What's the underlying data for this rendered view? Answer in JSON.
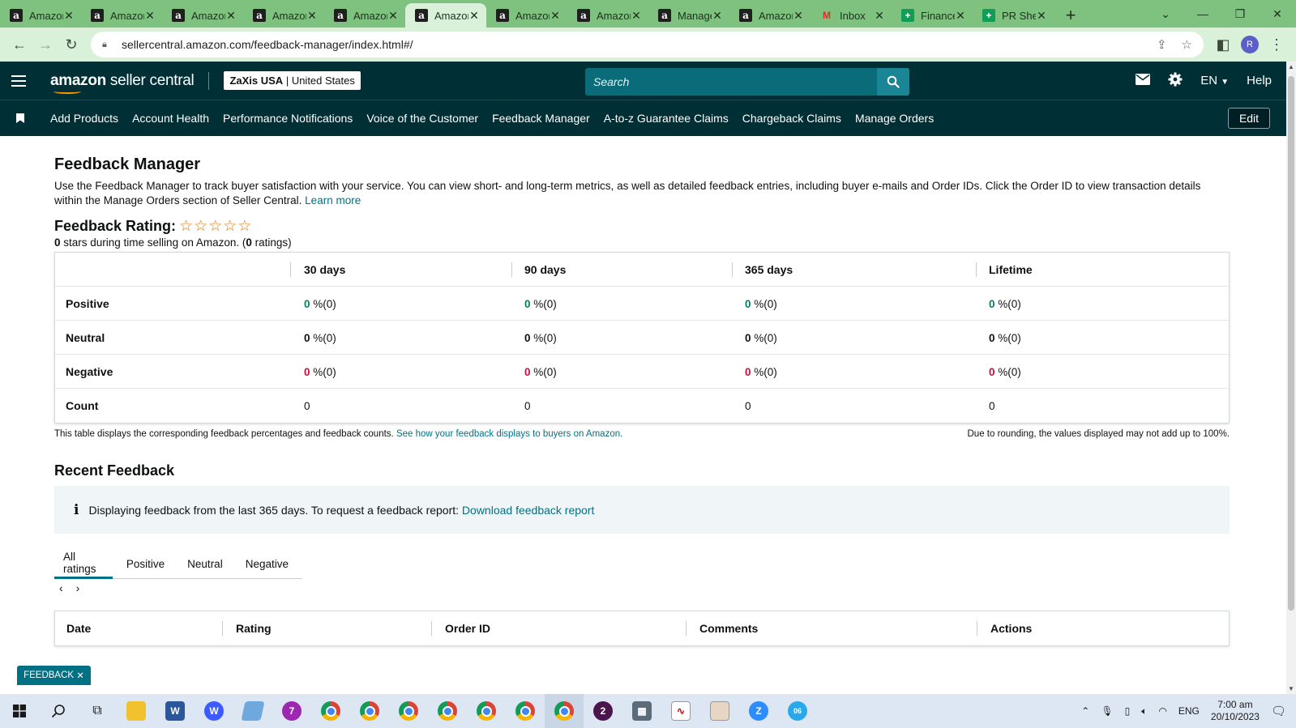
{
  "browser": {
    "tabs": [
      {
        "title": "Amazon",
        "favicon": "amazon-icon",
        "active": false
      },
      {
        "title": "Amazon",
        "favicon": "amazon-icon",
        "active": false
      },
      {
        "title": "Amazon",
        "favicon": "amazon-icon",
        "active": false
      },
      {
        "title": "Amazon",
        "favicon": "amazon-icon",
        "active": false
      },
      {
        "title": "Amazon",
        "favicon": "amazon-icon",
        "active": false
      },
      {
        "title": "Amazon",
        "favicon": "amazon-icon",
        "active": true
      },
      {
        "title": "Amazon",
        "favicon": "amazon-icon",
        "active": false
      },
      {
        "title": "Amazon",
        "favicon": "amazon-icon",
        "active": false
      },
      {
        "title": "Manage",
        "favicon": "amazon-icon",
        "active": false
      },
      {
        "title": "Amazon",
        "favicon": "amazon-icon",
        "active": false
      },
      {
        "title": "Inbox",
        "favicon": "gmail-icon",
        "active": false
      },
      {
        "title": "Finance",
        "favicon": "sheets-icon",
        "active": false
      },
      {
        "title": "PR Sheet",
        "favicon": "sheets-icon",
        "active": false
      }
    ],
    "url": "sellercentral.amazon.com/feedback-manager/index.html#/",
    "profile_initial": "R"
  },
  "header": {
    "logo_bold": "amazon",
    "logo_light": " seller central",
    "account_name": "ZaXis USA",
    "account_region": "United States",
    "search_placeholder": "Search",
    "language": "EN",
    "help_label": "Help"
  },
  "nav": {
    "items": [
      "Add Products",
      "Account Health",
      "Performance Notifications",
      "Voice of the Customer",
      "Feedback Manager",
      "A-to-z Guarantee Claims",
      "Chargeback Claims",
      "Manage Orders"
    ],
    "edit_label": "Edit"
  },
  "page": {
    "title": "Feedback Manager",
    "intro": "Use the Feedback Manager to track buyer satisfaction with your service. You can view short- and long-term metrics, as well as detailed feedback entries, including buyer e-mails and Order IDs. Click the Order ID to view transaction details within the Manage Orders section of Seller Central.",
    "learn_more": "Learn more",
    "rating_label": "Feedback Rating:",
    "rating_stars": 0,
    "star_count": 5,
    "stars_value": "0",
    "stars_text_mid": " stars during time selling on Amazon. (",
    "ratings_count": "0",
    "stars_text_end": " ratings)"
  },
  "ratings_table": {
    "columns": [
      "30 days",
      "90 days",
      "365 days",
      "Lifetime"
    ],
    "rows": [
      {
        "label": "Positive",
        "kind": "pos",
        "values": [
          {
            "n": "0",
            "s": " %(0)"
          },
          {
            "n": "0",
            "s": " %(0)"
          },
          {
            "n": "0",
            "s": " %(0)"
          },
          {
            "n": "0",
            "s": " %(0)"
          }
        ]
      },
      {
        "label": "Neutral",
        "kind": "neu",
        "values": [
          {
            "n": "0",
            "s": " %(0)"
          },
          {
            "n": "0",
            "s": " %(0)"
          },
          {
            "n": "0",
            "s": " %(0)"
          },
          {
            "n": "0",
            "s": " %(0)"
          }
        ]
      },
      {
        "label": "Negative",
        "kind": "neg",
        "values": [
          {
            "n": "0",
            "s": " %(0)"
          },
          {
            "n": "0",
            "s": " %(0)"
          },
          {
            "n": "0",
            "s": " %(0)"
          },
          {
            "n": "0",
            "s": " %(0)"
          }
        ]
      },
      {
        "label": "Count",
        "kind": "count",
        "values": [
          {
            "n": "",
            "s": "0"
          },
          {
            "n": "",
            "s": "0"
          },
          {
            "n": "",
            "s": "0"
          },
          {
            "n": "",
            "s": "0"
          }
        ]
      }
    ],
    "note": "This table displays the corresponding feedback percentages and feedback counts.",
    "note_link": "See how your feedback displays to buyers on Amazon.",
    "rounding_note": "Due to rounding, the values displayed may not add up to 100%."
  },
  "recent": {
    "title": "Recent Feedback",
    "info_text": "Displaying feedback from the last 365 days. To request a feedback report:",
    "info_link": "Download feedback report",
    "tabs": [
      "All ratings",
      "Positive",
      "Neutral",
      "Negative"
    ],
    "active_tab": 0,
    "columns": [
      "Date",
      "Rating",
      "Order ID",
      "Comments",
      "Actions"
    ]
  },
  "feedback_button": "FEEDBACK",
  "taskbar": {
    "language": "ENG",
    "time": "7:00 am",
    "date": "20/10/2023",
    "badges": {
      "chrome_1": "7",
      "slack": "2",
      "telegram": "06"
    }
  },
  "colors": {
    "header_bg": "#002f36",
    "link": "#007185",
    "positive": "#067d62",
    "negative": "#cc0c39",
    "tab_strip": "#7fc27f"
  }
}
